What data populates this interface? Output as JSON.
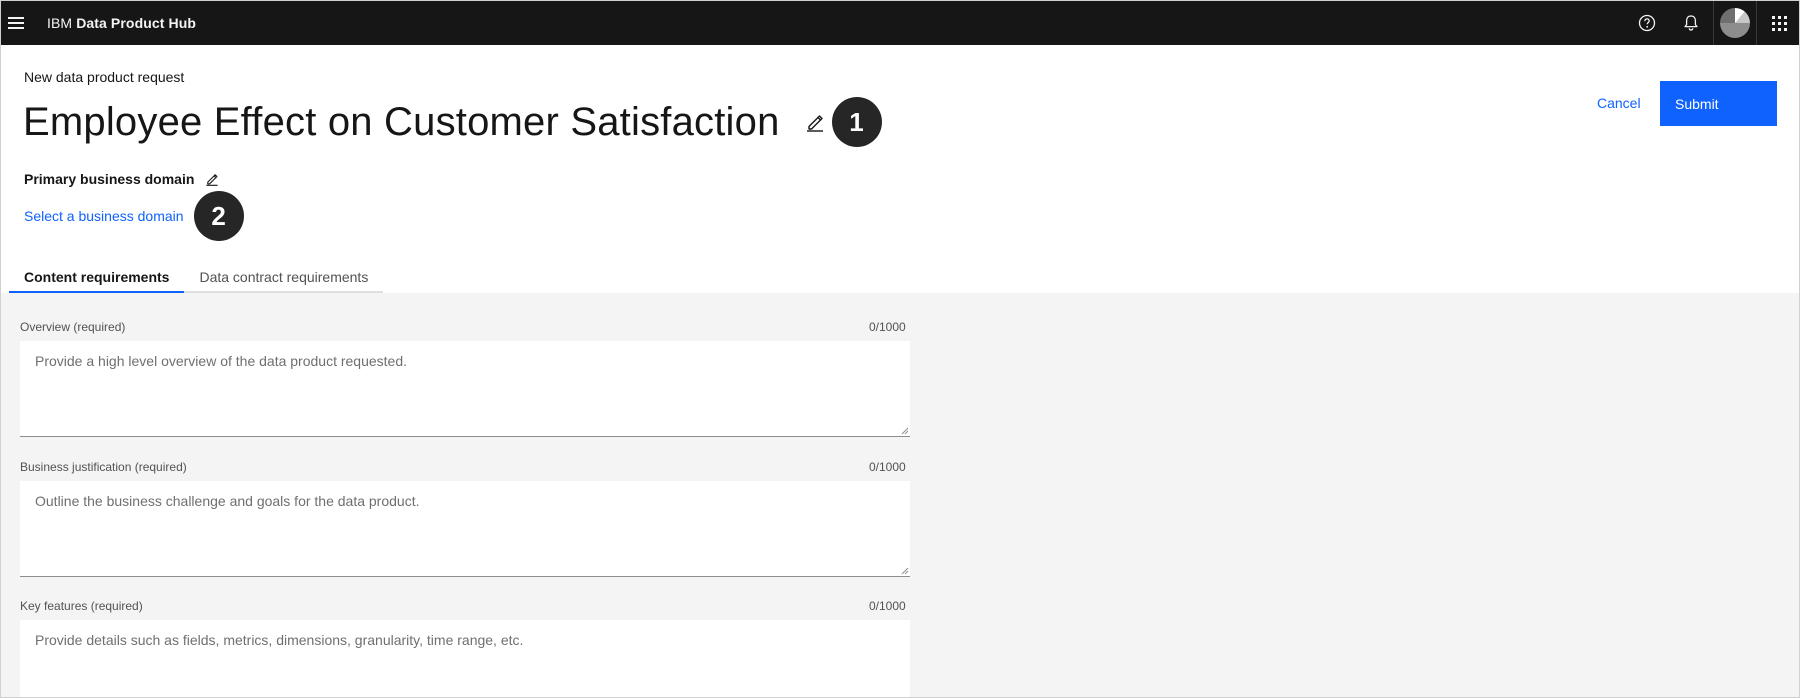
{
  "app": {
    "brand_prefix": "IBM",
    "brand_name": "Data Product Hub"
  },
  "header_icons": [
    "menu-icon",
    "help-icon",
    "notification-icon",
    "avatar",
    "app-switcher-icon"
  ],
  "page": {
    "subtitle": "New data product request",
    "title": "Employee Effect on Customer Satisfaction",
    "callout_1": "1",
    "callout_2": "2",
    "domain_label": "Primary business domain",
    "domain_link": "Select a business domain",
    "cancel_label": "Cancel",
    "submit_label": "Submit"
  },
  "tabs": [
    {
      "label": "Content requirements",
      "active": true
    },
    {
      "label": "Data contract requirements",
      "active": false
    }
  ],
  "fields": [
    {
      "label": "Overview (required)",
      "count": "0/1000",
      "placeholder": "Provide a high level overview of the data product requested."
    },
    {
      "label": "Business justification (required)",
      "count": "0/1000",
      "placeholder": "Outline the business challenge and goals for the data product."
    },
    {
      "label": "Key features (required)",
      "count": "0/1000",
      "placeholder": "Provide details such as fields, metrics, dimensions, granularity, time range, etc."
    }
  ],
  "colors": {
    "header_bg": "#161616",
    "accent": "#0f62fe",
    "content_bg": "#f4f4f4",
    "callout_bg": "#262626"
  }
}
